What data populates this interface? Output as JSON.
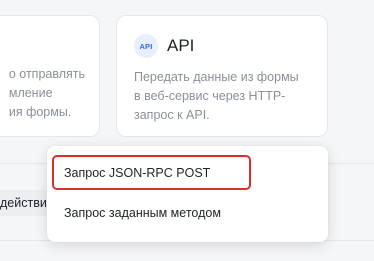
{
  "cards": {
    "left": {
      "description_lines": [
        "о отправлять",
        "мление",
        "ия формы."
      ]
    },
    "api": {
      "badge": "API",
      "title": "API",
      "description_lines": [
        "Передать данные из формы",
        "в веб-сервис через HTTP-",
        "запрос к API."
      ]
    }
  },
  "action_chip": {
    "label": "действи"
  },
  "dropdown": {
    "items": [
      {
        "label": "Запрос JSON-RPC POST"
      },
      {
        "label": "Запрос заданным методом"
      }
    ]
  },
  "colors": {
    "highlight": "#d9302a",
    "api_badge_bg": "#e8efff",
    "api_badge_text": "#2f6bf4"
  }
}
